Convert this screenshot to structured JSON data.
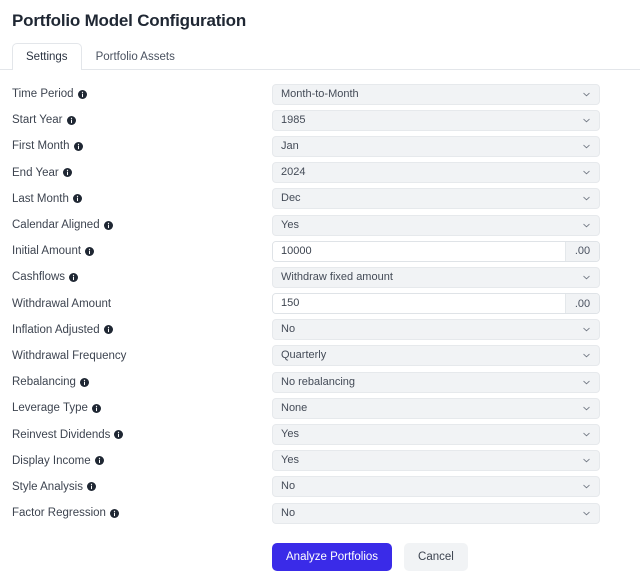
{
  "header": {
    "title": "Portfolio Model Configuration"
  },
  "tabs": [
    {
      "label": "Settings",
      "active": true
    },
    {
      "label": "Portfolio Assets",
      "active": false
    }
  ],
  "form": {
    "rows": [
      {
        "label": "Time Period",
        "info": true,
        "type": "select",
        "value": "Month-to-Month"
      },
      {
        "label": "Start Year",
        "info": true,
        "type": "select",
        "value": "1985"
      },
      {
        "label": "First Month",
        "info": true,
        "type": "select",
        "value": "Jan"
      },
      {
        "label": "End Year",
        "info": true,
        "type": "select",
        "value": "2024"
      },
      {
        "label": "Last Month",
        "info": true,
        "type": "select",
        "value": "Dec"
      },
      {
        "label": "Calendar Aligned",
        "info": true,
        "type": "select",
        "value": "Yes"
      },
      {
        "label": "Initial Amount",
        "info": true,
        "type": "text",
        "value": "10000",
        "addon": ".00"
      },
      {
        "label": "Cashflows",
        "info": true,
        "type": "select",
        "value": "Withdraw fixed amount"
      },
      {
        "label": "Withdrawal Amount",
        "info": false,
        "type": "text",
        "value": "150",
        "addon": ".00"
      },
      {
        "label": "Inflation Adjusted",
        "info": true,
        "type": "select",
        "value": "No"
      },
      {
        "label": "Withdrawal Frequency",
        "info": false,
        "type": "select",
        "value": "Quarterly"
      },
      {
        "label": "Rebalancing",
        "info": true,
        "type": "select",
        "value": "No rebalancing"
      },
      {
        "label": "Leverage Type",
        "info": true,
        "type": "select",
        "value": "None"
      },
      {
        "label": "Reinvest Dividends",
        "info": true,
        "type": "select",
        "value": "Yes"
      },
      {
        "label": "Display Income",
        "info": true,
        "type": "select",
        "value": "Yes"
      },
      {
        "label": "Style Analysis",
        "info": true,
        "type": "select",
        "value": "No"
      },
      {
        "label": "Factor Regression",
        "info": true,
        "type": "select",
        "value": "No"
      }
    ]
  },
  "actions": {
    "primary_label": "Analyze Portfolios",
    "secondary_label": "Cancel"
  },
  "icons": {
    "info": "info-circle-icon",
    "chevron": "chevron-down-icon"
  },
  "colors": {
    "primary_button": "#3a2be8",
    "secondary_button": "#f1f3f5",
    "select_background": "#f1f3f5",
    "border": "#e3e6ea",
    "text": "#3d4450"
  }
}
